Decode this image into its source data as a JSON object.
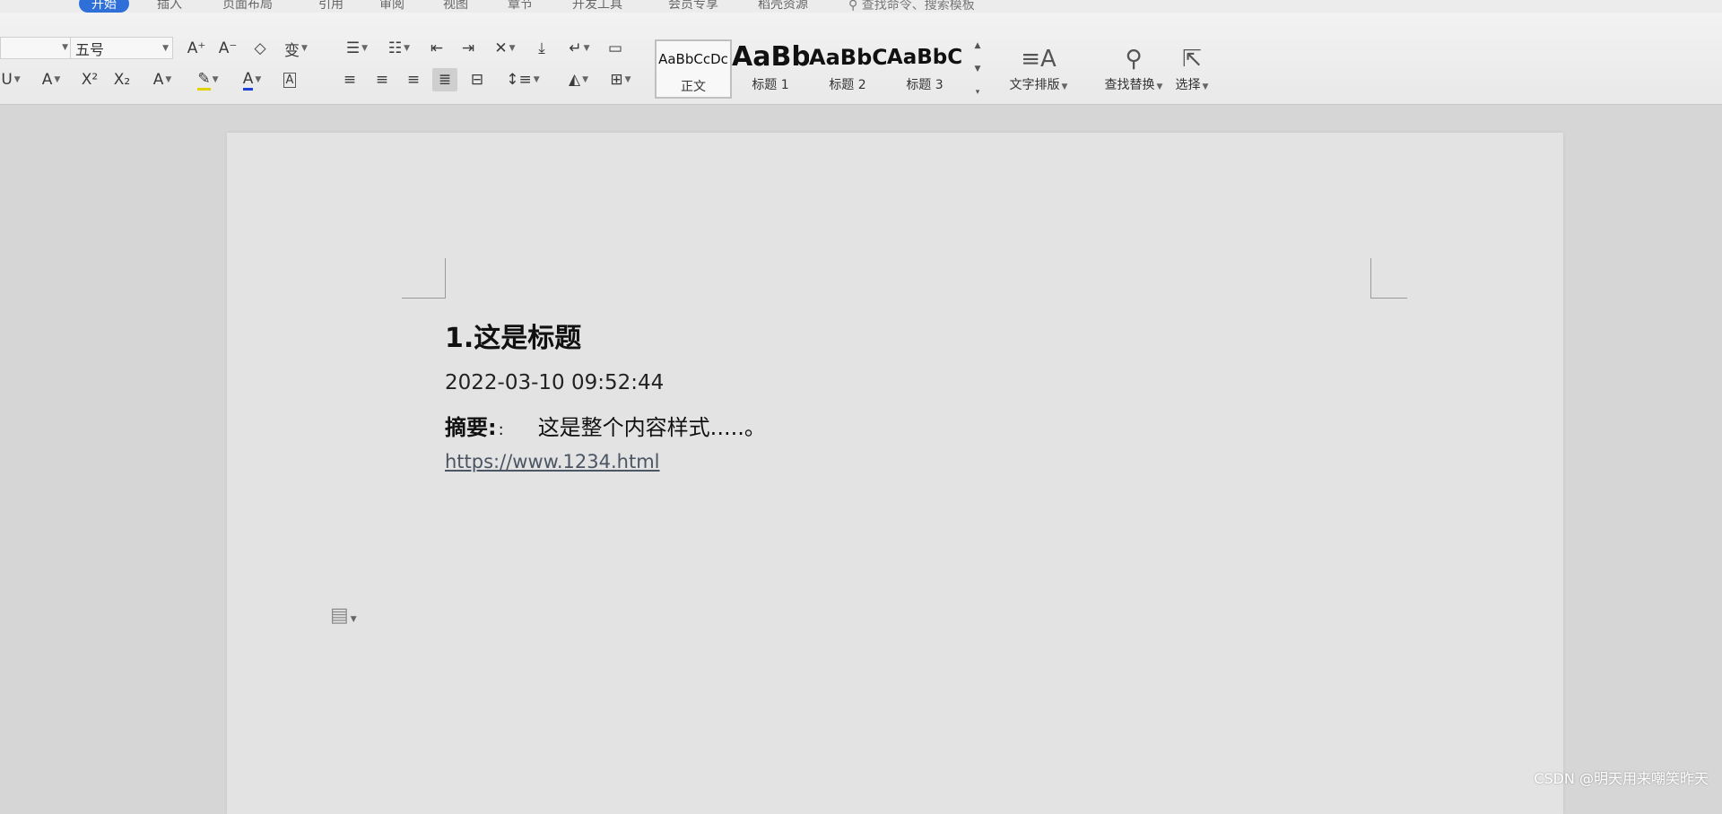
{
  "tabs": [
    "开始",
    "插入",
    "页面布局",
    "引用",
    "审阅",
    "视图",
    "章节",
    "开发工具",
    "会员专享",
    "稻壳资源"
  ],
  "search_commands": "查找命令、搜索模板",
  "font": {
    "size": "五号"
  },
  "styles": [
    {
      "preview": "AaBbCcDc",
      "name": "正文"
    },
    {
      "preview": "AaBbC",
      "name": "标题 1"
    },
    {
      "preview": "AaBbC",
      "name": "标题 2"
    },
    {
      "preview": "AaBbC",
      "name": "标题 3"
    }
  ],
  "tools": {
    "text_layout": "文字排版",
    "find_replace": "查找替换",
    "select": "选择"
  },
  "document": {
    "heading": "1.这是标题",
    "date": "2022-03-10 09:52:44",
    "abstract_label": "摘要:",
    "abstract_colon": ":",
    "abstract_text": "这是整个内容样式.....。",
    "link": "https://www.1234.html"
  },
  "watermark": "CSDN @明天用来嘲笑昨天"
}
